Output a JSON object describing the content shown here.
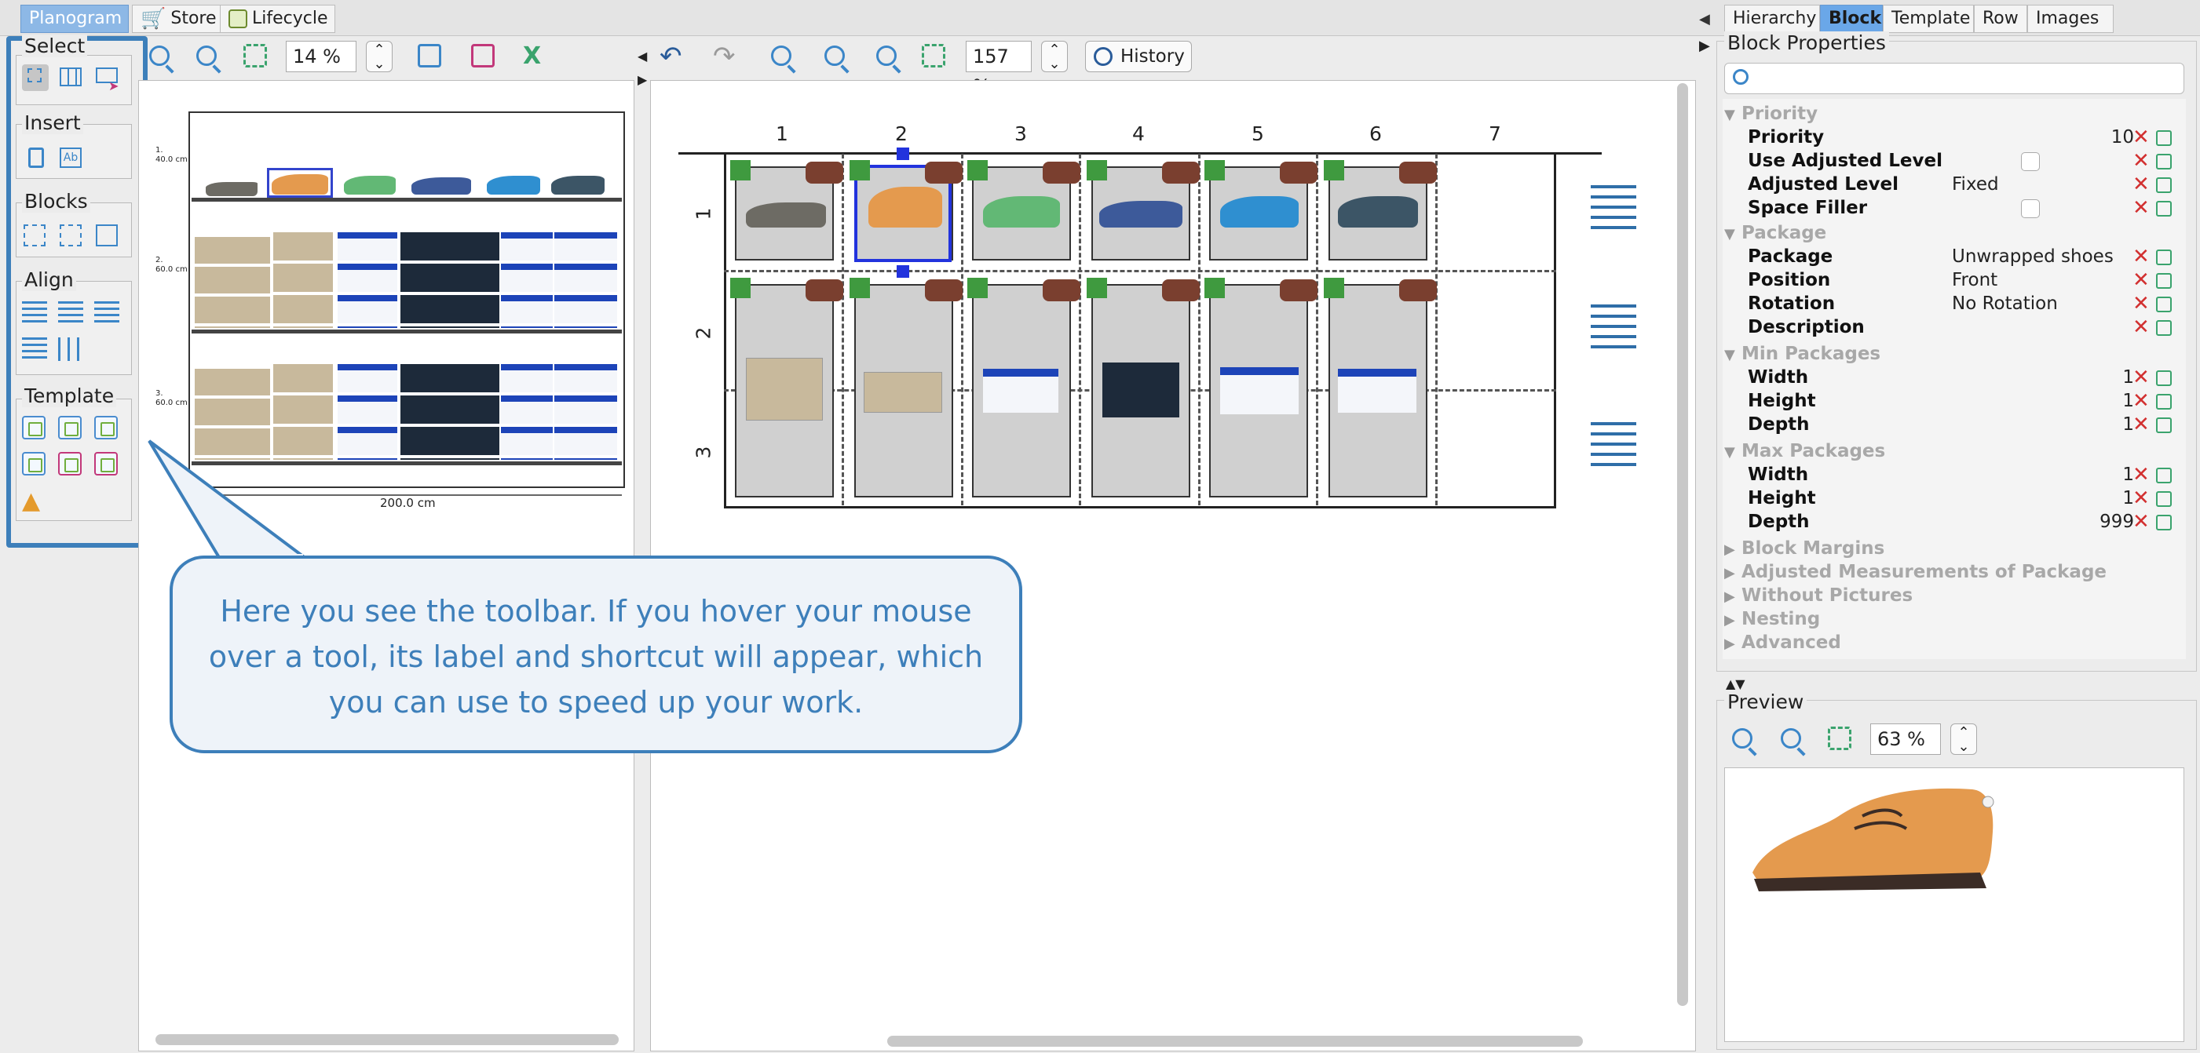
{
  "tabs": {
    "planogram": "Planogram",
    "store": "Store",
    "lifecycle": "Lifecycle"
  },
  "toolbar_sections": {
    "select": "Select",
    "insert": "Insert",
    "blocks": "Blocks",
    "align": "Align",
    "template": "Template"
  },
  "left_pane": {
    "zoom": "14 %",
    "width_label": "200.0 cm",
    "shelf_labels": [
      "1.\n40.0 cm",
      "2.\n60.0 cm",
      "3.\n60.0 cm"
    ]
  },
  "center_pane": {
    "zoom": "157 %",
    "history_label": "History",
    "columns": [
      "1",
      "2",
      "3",
      "4",
      "5",
      "6",
      "7"
    ],
    "rows": [
      "1",
      "2",
      "3"
    ]
  },
  "right_tabs": {
    "hierarchy": "Hierarchy",
    "block": "Block",
    "template": "Template",
    "row": "Row",
    "images": "Images"
  },
  "block_properties": {
    "title": "Block Properties",
    "search_placeholder": "",
    "groups": {
      "priority": "Priority",
      "package": "Package",
      "min_packages": "Min Packages",
      "max_packages": "Max Packages",
      "block_margins": "Block Margins",
      "adjusted_measurements": "Adjusted Measurements of Package",
      "without_pictures": "Without Pictures",
      "nesting": "Nesting",
      "advanced": "Advanced"
    },
    "rows": {
      "priority": {
        "key": "Priority",
        "value": "10"
      },
      "use_adjusted_level": {
        "key": "Use Adjusted Level",
        "checked": false
      },
      "adjusted_level": {
        "key": "Adjusted Level",
        "value": "Fixed"
      },
      "space_filler": {
        "key": "Space Filler",
        "checked": false
      },
      "package": {
        "key": "Package",
        "value": "Unwrapped shoes"
      },
      "position": {
        "key": "Position",
        "value": "Front"
      },
      "rotation": {
        "key": "Rotation",
        "value": "No Rotation"
      },
      "description": {
        "key": "Description",
        "value": ""
      },
      "min_width": {
        "key": "Width",
        "value": "1"
      },
      "min_height": {
        "key": "Height",
        "value": "1"
      },
      "min_depth": {
        "key": "Depth",
        "value": "1"
      },
      "max_width": {
        "key": "Width",
        "value": "1"
      },
      "max_height": {
        "key": "Height",
        "value": "1"
      },
      "max_depth": {
        "key": "Depth",
        "value": "999"
      }
    }
  },
  "preview": {
    "title": "Preview",
    "zoom": "63 %"
  },
  "callout": {
    "text": "Here you see the toolbar. If you hover your mouse over a tool, its label and shortcut will appear, which you can use to speed up your work."
  },
  "colors": {
    "accent": "#3d7fba",
    "selected_tab": "#8db8e6",
    "delete": "#d23030",
    "block_green": "#3f9a3f",
    "block_brown": "#7a3f2f",
    "shoe_orange": "#e49a4e"
  }
}
